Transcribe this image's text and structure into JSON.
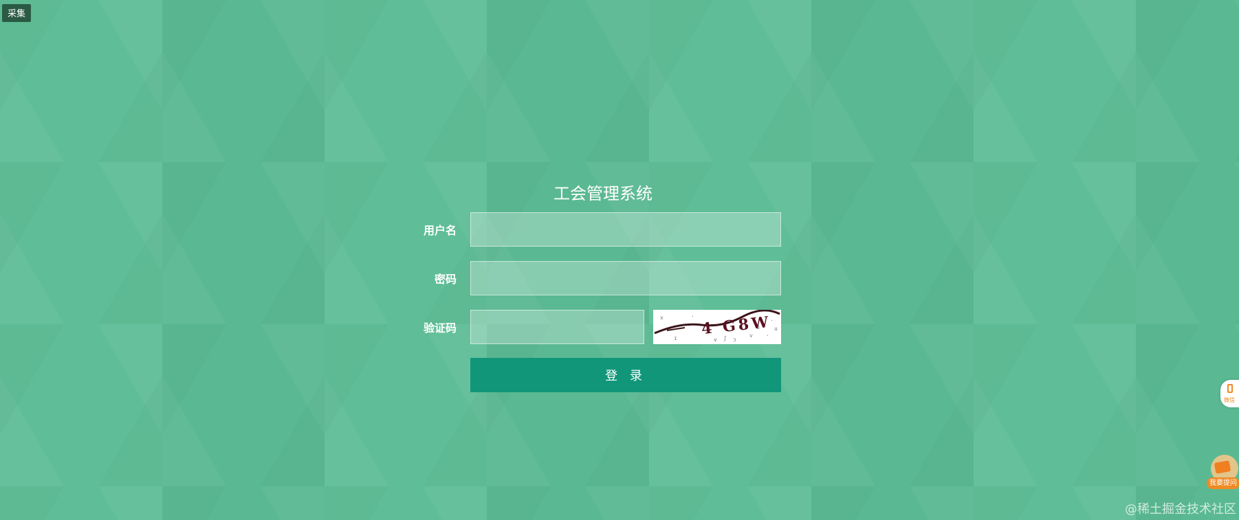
{
  "top_tag": {
    "label": "采集"
  },
  "login": {
    "title": "工会管理系统",
    "username_label": "用户名",
    "username_value": "",
    "password_label": "密码",
    "password_value": "",
    "captcha_label": "验证码",
    "captcha_value": "",
    "captcha_image_text": "4 G8W",
    "submit_label": "登 录"
  },
  "floating": {
    "side_label": "微信",
    "feedback_label": "我要提问"
  },
  "watermark": "@稀土掘金技术社区",
  "colors": {
    "background": "#5cbd95",
    "button": "#11967a",
    "accent_orange": "#f08a24"
  },
  "icons": [
    "phone-icon",
    "feedback-icon",
    "captcha-image"
  ]
}
